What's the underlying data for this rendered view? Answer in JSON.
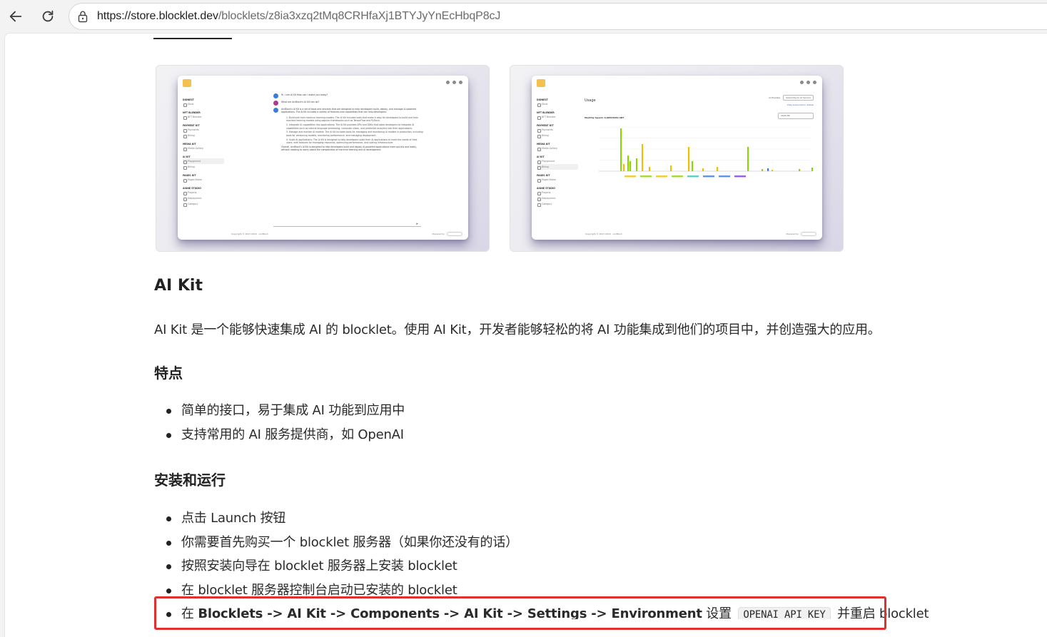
{
  "browser": {
    "url_host": "https://store.blocklet.dev",
    "url_path": "/blocklets/z8ia3xzq2tMq8CRHfaXj1BTYJyYnEcHbqP8cJ"
  },
  "screenshot_playground": {
    "sidebar": [
      {
        "group": "DIDNEST",
        "items": [
          "Dinet"
        ]
      },
      {
        "group": "NFT BLENDER",
        "items": [
          "NFT Blender"
        ]
      },
      {
        "group": "PAYMENT KIT",
        "items": [
          "Payments",
          "Billing"
        ]
      },
      {
        "group": "MEDIA KIT",
        "items": [
          "Media Gallery"
        ]
      },
      {
        "group": "AI KIT",
        "items": [
          "Playground",
          "Billing"
        ]
      },
      {
        "group": "PAGES KIT",
        "items": [
          "Pages Maker"
        ]
      },
      {
        "group": "AIGNE STUDIO",
        "items": [
          "Projects",
          "Deployment",
          "Category"
        ]
      }
    ],
    "messages": [
      {
        "text": "Hi, I am AI Kit How can I assist you today?"
      },
      {
        "text": "What are ArcBlock's AI Kit can do?"
      },
      {
        "text": "ArcBlock's AI Kit is a set of tools and services that are designed to help developers build, deploy, and manage AI-powered applications. The AI Kit includes a variety of features and capabilities that can help developers:"
      }
    ],
    "list": [
      "1. Build and train machine learning models: The AI Kit includes tools that make it easy for developers to build and train machine learning models using popular frameworks such as TensorFlow and PyTorch.",
      "2. Integrate AI capabilities into applications: The AI Kit provides APIs and SDKs that allow developers to integrate AI capabilities such as natural language processing, computer vision, and predictive analytics into their applications.",
      "3. Manage and monitor AI models: The AI Kit includes tools for managing and monitoring AI models in production, including tools for versioning models, monitoring performance, and managing deployment.",
      "4. Scale AI applications: The AI Kit is designed to help developers scale their AI applications to meet the needs of their users, with features for managing resources, optimizing performance, and scaling infrastructure."
    ],
    "closing": "Overall, ArcBlock's AI Kit is designed to help developers build and deploy AI-powered applications more quickly and easily, without needing to worry about the complexities of machine learning and AI development.",
    "footer": "Copyright © 2017-2024 · ArcBlock",
    "powered": "Powered by"
  },
  "screenshot_usage": {
    "title": "Usage",
    "provider_label": "AI Provider",
    "provider_value": "Subscribe to AI Service",
    "link": "View subscription details",
    "month_label": "Monthly Spend: 0.00523040 ABT",
    "date_label": "Select Month",
    "date_value": "2024-06",
    "footer": "Copyright © 2017-2024 · ArcBlock",
    "powered": "Powered by"
  },
  "article": {
    "title": "AI Kit",
    "intro": "AI Kit 是一个能够快速集成 AI 的 blocklet。使用 AI Kit，开发者能够轻松的将 AI 功能集成到他们的项目中，并创造强大的应用。",
    "features_heading": "特点",
    "features": [
      "简单的接口，易于集成 AI 功能到应用中",
      "支持常用的 AI 服务提供商，如 OpenAI"
    ],
    "install_heading": "安装和运行",
    "install_steps": [
      "点击 Launch 按钮",
      "你需要首先购买一个 blocklet 服务器（如果你还没有的话）",
      "按照安装向导在 blocklet 服务器上安装 blocklet",
      "在 blocklet 服务器控制台启动已安装的 blocklet"
    ],
    "last_step": {
      "prefix": "在 ",
      "path": "Blocklets -> AI Kit -> Components -> AI Kit -> Settings -> Environment",
      "middle": " 设置 ",
      "code": "OPENAI_API_KEY",
      "suffix": " 并重启 blocklet"
    }
  },
  "colors": {
    "highlight": "#e03131",
    "bar_green": "#8fd400",
    "bar_yellow": "#f0c000"
  }
}
